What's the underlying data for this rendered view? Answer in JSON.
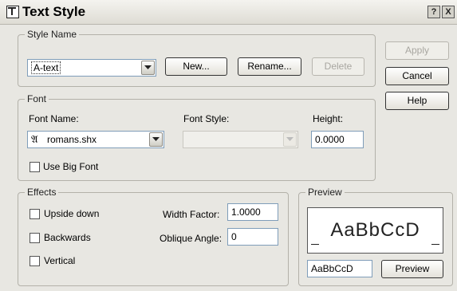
{
  "window": {
    "title": "Text Style",
    "help_glyph": "?",
    "close_glyph": "X",
    "app_icon": "text-style-icon"
  },
  "style_name": {
    "legend": "Style Name",
    "value": "A-text",
    "new_label": "New...",
    "rename_label": "Rename...",
    "delete_label": "Delete"
  },
  "side_buttons": {
    "apply": "Apply",
    "cancel": "Cancel",
    "help": "Help"
  },
  "font": {
    "legend": "Font",
    "font_name_label": "Font Name:",
    "font_name_value": "romans.shx",
    "font_icon": "shx-font-icon",
    "font_style_label": "Font Style:",
    "font_style_value": "",
    "height_label": "Height:",
    "height_value": "0.0000",
    "use_big_font_label": "Use Big Font",
    "use_big_font_checked": false
  },
  "effects": {
    "legend": "Effects",
    "upside_down_label": "Upside down",
    "upside_down_checked": false,
    "backwards_label": "Backwards",
    "backwards_checked": false,
    "vertical_label": "Vertical",
    "vertical_checked": false,
    "width_factor_label": "Width Factor:",
    "width_factor_value": "1.0000",
    "oblique_angle_label": "Oblique Angle:",
    "oblique_angle_value": "0"
  },
  "preview": {
    "legend": "Preview",
    "display_text": "AaBbCcD",
    "input_value": "AaBbCcD",
    "button_label": "Preview"
  }
}
